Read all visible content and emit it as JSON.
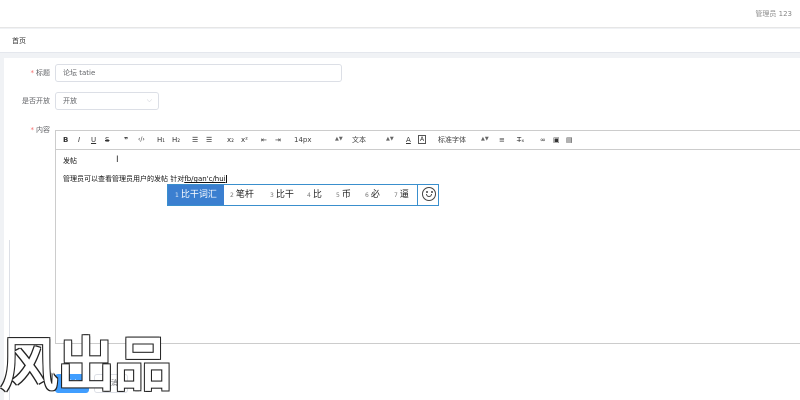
{
  "header": {
    "user": "管理员 123"
  },
  "tabs": [
    {
      "label": "首页"
    }
  ],
  "form": {
    "title": {
      "label": "标题",
      "value": "论坛 tatie"
    },
    "public": {
      "label": "是否开放",
      "value": "开放"
    },
    "content": {
      "label": "内容"
    }
  },
  "editor": {
    "toolbar": {
      "bold": "B",
      "italic": "I",
      "underline": "U",
      "strike": "S",
      "quote": "❞",
      "code": "‹/›",
      "h1": "H₁",
      "h2": "H₂",
      "sub": "x₂",
      "sup": "x²",
      "font_size": "14px",
      "text_type": "文本",
      "font_family": "标准字体",
      "clear_format": "T̶ₓ"
    },
    "lines": [
      "发帖",
      "管理员可以查看管理员用户的发帖  针对fb/gan'c/hui"
    ],
    "line2_plain": "管理员可以查看管理员用户的发帖  针对",
    "line2_composition": "fb/gan'c/hui"
  },
  "ime": {
    "candidates": [
      {
        "n": "1",
        "text": "比干词汇"
      },
      {
        "n": "2",
        "text": "笔杆"
      },
      {
        "n": "3",
        "text": "比干"
      },
      {
        "n": "4",
        "text": "比"
      },
      {
        "n": "5",
        "text": "币"
      },
      {
        "n": "6",
        "text": "必"
      },
      {
        "n": "7",
        "text": "逼"
      }
    ]
  },
  "watermark": "风出品",
  "buttons": {
    "submit": "提交",
    "cancel": "取消"
  },
  "colors": {
    "primary": "#409eff",
    "ime_select": "#3b7fd0",
    "required": "#f56c6c"
  }
}
